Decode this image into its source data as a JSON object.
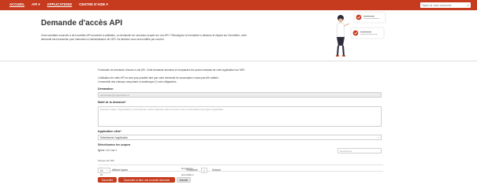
{
  "nav": {
    "items": [
      {
        "label": "ACCUEIL",
        "active": true
      },
      {
        "label": "API ▾",
        "active": false
      },
      {
        "label": "APPLICATIONS",
        "active": true
      },
      {
        "label": "CENTRE D'AIDE ▾",
        "active": false
      }
    ],
    "search_placeholder": "Tapez ici votre recherche"
  },
  "hero": {
    "title": "Demande d'accès API",
    "intro": "Vous souhaitez souscrire à de nouvelles API soumises à validation, ou demander de nouveaux scopes sur vos API ? Renseignez le formulaire ci-dessous et cliquez sur Soumettre, votre demande sera transmise pour instruction à l'administrateur de l'API. Sa décision vous sera notifiée par courriel."
  },
  "form": {
    "info1": "Formulaire de demande d'accès à une API. Cette demande annulera et remplacera les accès existants de votre application sur l'API.",
    "info2": "L'utilisation de cette API ne sera pas possible tant que votre demande de souscription n'aura pas été validée.",
    "info3": "L'ensemble des champs comportant un astérisque (*) sont obligatoires.",
    "demandeur_label": "Demandeur",
    "demandeur_value": "demandeur@organisation.fr",
    "motif_label": "Motif de la demande",
    "motif_placeholder": "Précisez l'objet, l'organisation ou l'entreprise. Action attendue dans le besoin. Nom et identifiant de projet si applicable",
    "app_label": "Application cible",
    "app_select_value": "Sélectionner l'application",
    "scopes_label": "Sélectionnez les scopes",
    "range_text": "lignes 1 à 1 sur 1",
    "search_placeholder": "Rechercher",
    "table": {
      "col1_header": "Scopes de l'API",
      "col2_header": "Description",
      "row1": {
        "col1": "a",
        "col2": "Description A"
      },
      "row2": {
        "col1": "2d",
        "col2": "autorisation"
      }
    },
    "per_page": "10",
    "per_page_label": "Afficher lignes",
    "prev": "Précédent",
    "page": "1",
    "next": "Suivant",
    "submit": "Soumettre",
    "submit_new": "Soumettre et faire une nouvelle demande",
    "cancel": "Annuler"
  },
  "colors": {
    "accent": "#c63a1d"
  }
}
